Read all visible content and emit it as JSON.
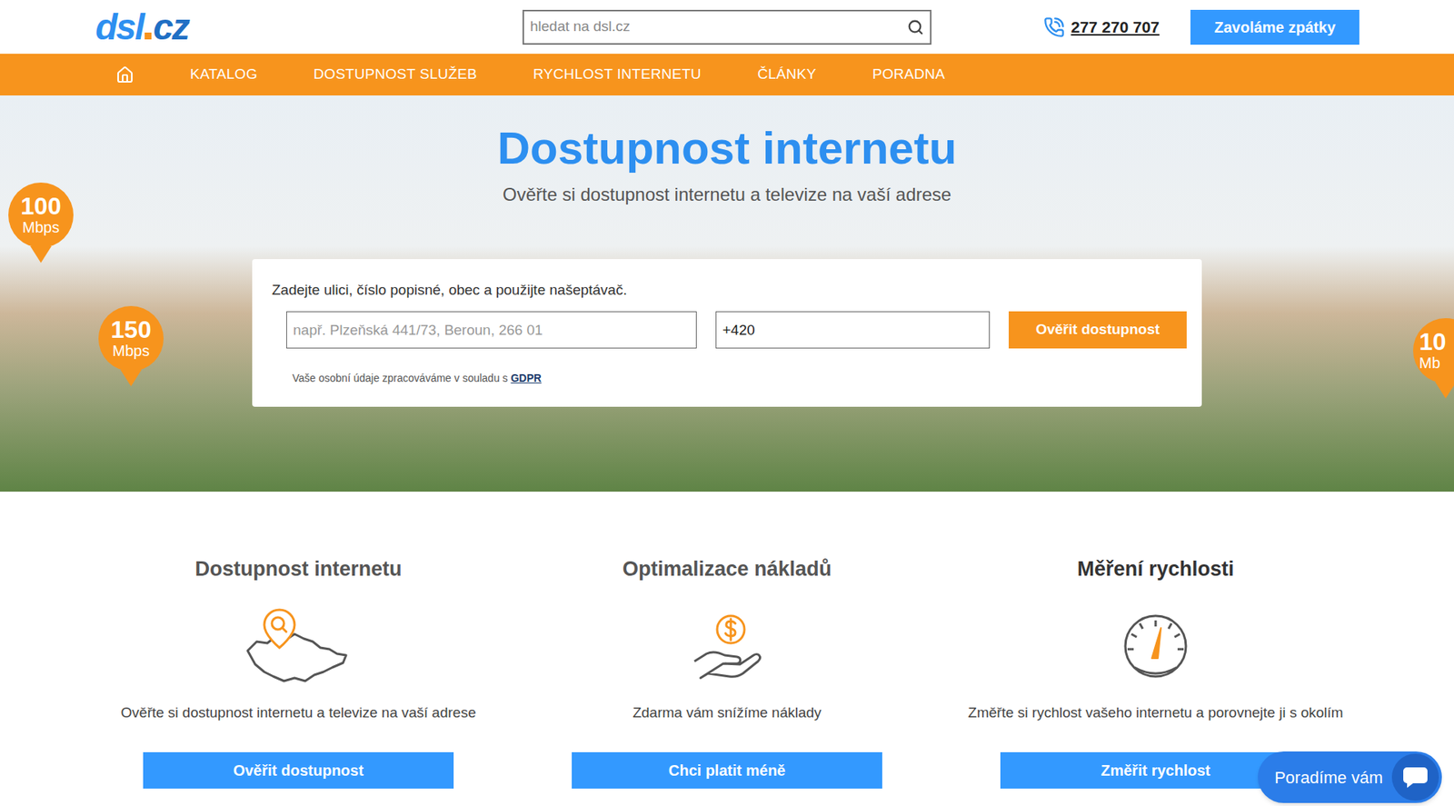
{
  "header": {
    "logo": {
      "name": "dsl",
      "tld": "cz"
    },
    "search": {
      "placeholder": "hledat na dsl.cz"
    },
    "phone": "277 270 707",
    "callback_button": "Zavoláme zpátky"
  },
  "nav": [
    {
      "label": "KATALOG",
      "selected": false
    },
    {
      "label": "DOSTUPNOST SLUŽEB",
      "selected": false
    },
    {
      "label": "RYCHLOST INTERNETU",
      "selected": false
    },
    {
      "label": "ČLÁNKY",
      "selected": false
    },
    {
      "label": "PORADNA",
      "selected": false
    }
  ],
  "hero": {
    "title": "Dostupnost internetu",
    "subtitle": "Ověřte si dostupnost internetu a televize na vaší adrese",
    "pins": [
      {
        "value": "100",
        "unit": "Mbps"
      },
      {
        "value": "150",
        "unit": "Mbps"
      },
      {
        "value": "10",
        "unit": "Mb"
      }
    ]
  },
  "form": {
    "label": "Zadejte ulici, číslo popisné, obec a použijte našeptávač.",
    "address_placeholder": "např. Plzeňská 441/73, Beroun, 266 01",
    "phone_value": "+420",
    "submit": "Ověřit dostupnost",
    "gdpr_text": "Vaše osobní údaje zpracováváme v souladu s",
    "gdpr_link": "GDPR"
  },
  "features": [
    {
      "kind": "map",
      "title": "Dostupnost internetu",
      "description": "Ověřte si dostupnost internetu a televize na vaší adrese",
      "button": "Ověřit dostupnost"
    },
    {
      "kind": "money",
      "title": "Optimalizace nákladů",
      "description": "Zdarma vám snížíme náklady",
      "button": "Chci platit méně"
    },
    {
      "kind": "speed",
      "title": "Měření rychlosti",
      "description": "Změřte si rychlost vašeho internetu a porovnejte ji s okolím",
      "button": "Změřit rychlost"
    }
  ],
  "chat": {
    "label": "Poradíme vám"
  }
}
